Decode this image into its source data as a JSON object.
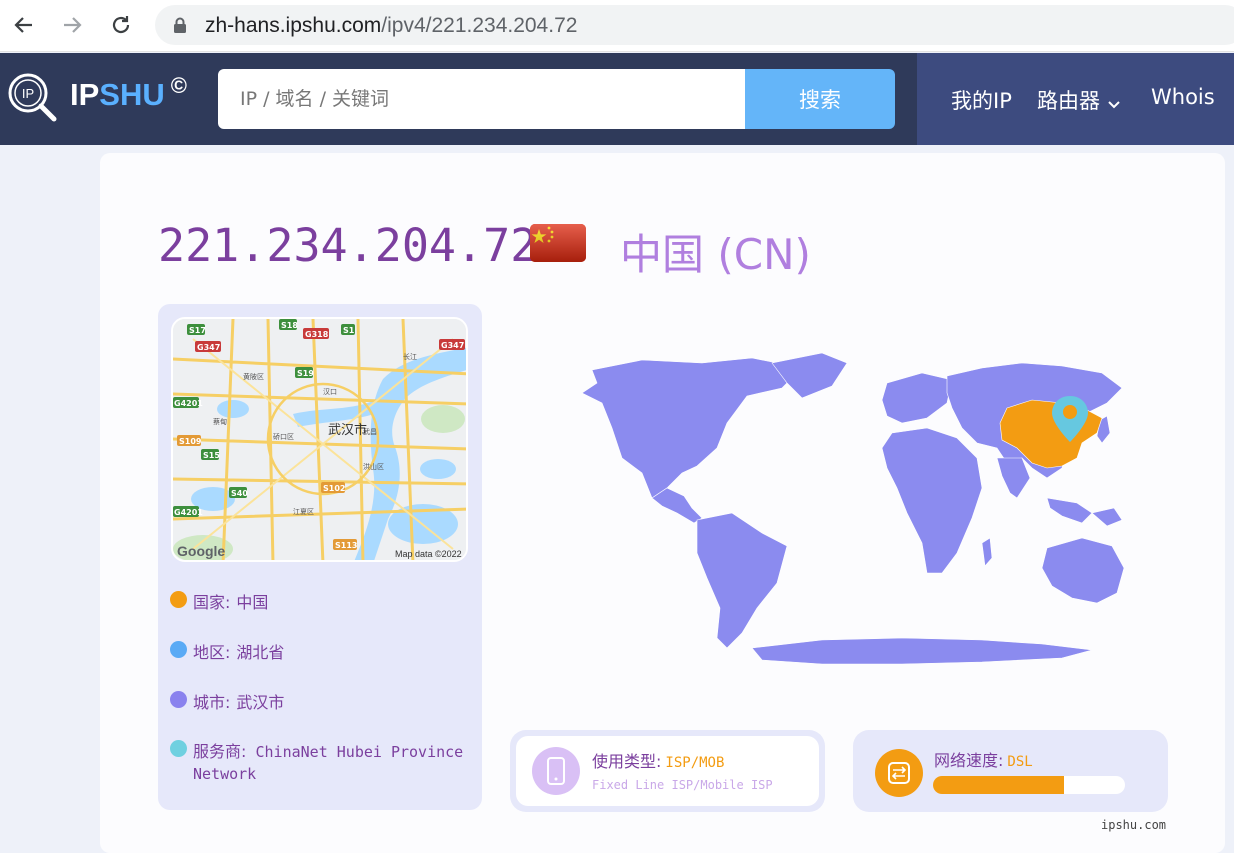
{
  "browser": {
    "url_host": "zh-hans.ipshu.com",
    "url_path": "/ipv4/221.234.204.72"
  },
  "header": {
    "logo_ip": "IP",
    "logo_shu": "SHU",
    "logo_mark": "©",
    "search_placeholder": "IP / 域名 / 关键词",
    "search_button": "搜索",
    "nav": {
      "my_ip": "我的IP",
      "router": "路由器",
      "whois": "Whois"
    }
  },
  "main": {
    "ip": "221.234.204.72",
    "country_title": "中国 (CN)"
  },
  "mini_map": {
    "city_label": "武汉市",
    "credit_logo": "Google",
    "credit_data": "Map data ©2022",
    "road_labels": [
      "S17",
      "S18",
      "G318",
      "S1",
      "G347",
      "G347",
      "S19",
      "G4201",
      "S109",
      "S15",
      "S40",
      "S102",
      "G4201",
      "S113"
    ],
    "place_labels": [
      "长江",
      "汉口",
      "硚口区",
      "黄陂区",
      "武昌",
      "洪山区",
      "蔡甸",
      "江夏区"
    ]
  },
  "info": {
    "country_label": "国家:",
    "country_value": "中国",
    "region_label": "地区:",
    "region_value": "湖北省",
    "city_label": "城市:",
    "city_value": "武汉市",
    "isp_label": "服务商:",
    "isp_value": "ChinaNet Hubei Province",
    "isp_value_line2": "Network"
  },
  "usage": {
    "label": "使用类型:",
    "value": "ISP/MOB",
    "sub": "Fixed Line ISP/Mobile ISP"
  },
  "speed": {
    "label": "网络速度:",
    "value": "DSL",
    "level_fraction": 0.68
  },
  "footer": {
    "brand": "ipshu.com"
  },
  "colors": {
    "header_bg": "#2f3a5a",
    "nav_bg": "#3d4b7f",
    "search_button": "#64b5f9",
    "title_purple": "#7b3f9e",
    "country_purple": "#b07fdf",
    "country_dot": "#f39c12",
    "region_dot": "#5aaaf5",
    "city_dot": "#8a82ee",
    "isp_dot": "#6fd0e0",
    "map_land": "#8b8bef",
    "map_highlight": "#f39c12"
  },
  "icons": [
    "back-arrow-icon",
    "forward-arrow-icon",
    "reload-icon",
    "lock-icon",
    "ipshu-logo-icon",
    "chevron-down-icon",
    "china-flag-icon",
    "location-pin-icon",
    "phone-icon",
    "router-icon"
  ]
}
